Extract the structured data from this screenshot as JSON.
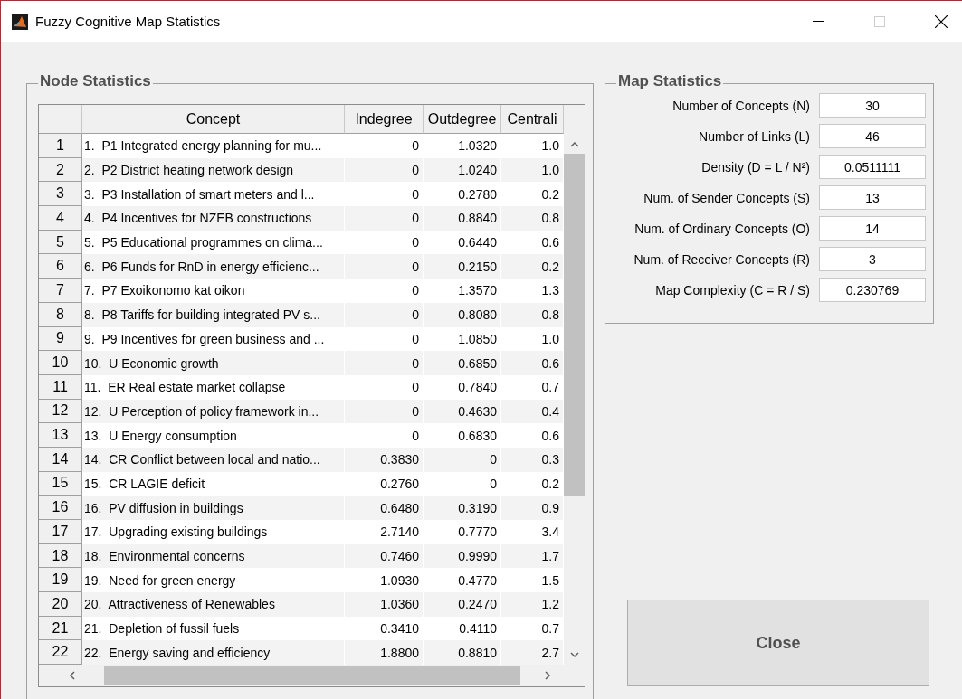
{
  "window": {
    "title": "Fuzzy Cognitive Map Statistics"
  },
  "node_statistics": {
    "title": "Node Statistics",
    "table": {
      "columns": [
        "Concept",
        "Indegree",
        "Outdegree",
        "Centrali"
      ],
      "rows": [
        {
          "index": "1",
          "cells": [
            "1.  P1 Integrated energy planning for mu...",
            "0",
            "1.0320",
            "1.0"
          ]
        },
        {
          "index": "2",
          "cells": [
            "2.  P2 District heating network design",
            "0",
            "1.0240",
            "1.0"
          ]
        },
        {
          "index": "3",
          "cells": [
            "3.  P3 Installation of smart meters and l...",
            "0",
            "0.2780",
            "0.2"
          ]
        },
        {
          "index": "4",
          "cells": [
            "4.  P4 Incentives for NZEB constructions",
            "0",
            "0.8840",
            "0.8"
          ]
        },
        {
          "index": "5",
          "cells": [
            "5.  P5 Educational programmes on clima...",
            "0",
            "0.6440",
            "0.6"
          ]
        },
        {
          "index": "6",
          "cells": [
            "6.  P6 Funds for RnD in energy efficienc...",
            "0",
            "0.2150",
            "0.2"
          ]
        },
        {
          "index": "7",
          "cells": [
            "7.  P7 Exoikonomo kat oikon",
            "0",
            "1.3570",
            "1.3"
          ]
        },
        {
          "index": "8",
          "cells": [
            "8.  P8 Tariffs for building integrated PV s...",
            "0",
            "0.8080",
            "0.8"
          ]
        },
        {
          "index": "9",
          "cells": [
            "9.  P9 Incentives for green business and ...",
            "0",
            "1.0850",
            "1.0"
          ]
        },
        {
          "index": "10",
          "cells": [
            "10.  U Economic growth",
            "0",
            "0.6850",
            "0.6"
          ]
        },
        {
          "index": "11",
          "cells": [
            "11.  ER Real estate market collapse",
            "0",
            "0.7840",
            "0.7"
          ]
        },
        {
          "index": "12",
          "cells": [
            "12.  U Perception of policy framework in...",
            "0",
            "0.4630",
            "0.4"
          ]
        },
        {
          "index": "13",
          "cells": [
            "13.  U Energy consumption",
            "0",
            "0.6830",
            "0.6"
          ]
        },
        {
          "index": "14",
          "cells": [
            "14.  CR Conflict between local and natio...",
            "0.3830",
            "0",
            "0.3"
          ]
        },
        {
          "index": "15",
          "cells": [
            "15.  CR LAGIE deficit",
            "0.2760",
            "0",
            "0.2"
          ]
        },
        {
          "index": "16",
          "cells": [
            "16.  PV diffusion in buildings",
            "0.6480",
            "0.3190",
            "0.9"
          ]
        },
        {
          "index": "17",
          "cells": [
            "17.  Upgrading existing buildings",
            "2.7140",
            "0.7770",
            "3.4"
          ]
        },
        {
          "index": "18",
          "cells": [
            "18.  Environmental concerns",
            "0.7460",
            "0.9990",
            "1.7"
          ]
        },
        {
          "index": "19",
          "cells": [
            "19.  Need for green energy",
            "1.0930",
            "0.4770",
            "1.5"
          ]
        },
        {
          "index": "20",
          "cells": [
            "20.  Attractiveness of Renewables",
            "1.0360",
            "0.2470",
            "1.2"
          ]
        },
        {
          "index": "21",
          "cells": [
            "21.  Depletion of fussil fuels",
            "0.3410",
            "0.4110",
            "0.7"
          ]
        },
        {
          "index": "22",
          "cells": [
            "22.  Energy saving and efficiency",
            "1.8800",
            "0.8810",
            "2.7"
          ]
        }
      ]
    }
  },
  "map_statistics": {
    "title": "Map Statistics",
    "fields": [
      {
        "label": "Number of Concepts (N)",
        "value": "30"
      },
      {
        "label": "Number of Links (L)",
        "value": "46"
      },
      {
        "label": "Density (D  = L / N²)",
        "value": "0.0511111"
      },
      {
        "label": "Num. of Sender Concepts (S)",
        "value": "13"
      },
      {
        "label": "Num. of Ordinary Concepts (O)",
        "value": "14"
      },
      {
        "label": "Num. of Receiver Concepts (R)",
        "value": "3"
      },
      {
        "label": "Map Complexity (C = R / S)",
        "value": "0.230769"
      }
    ]
  },
  "buttons": [
    {
      "label": "Close"
    }
  ]
}
